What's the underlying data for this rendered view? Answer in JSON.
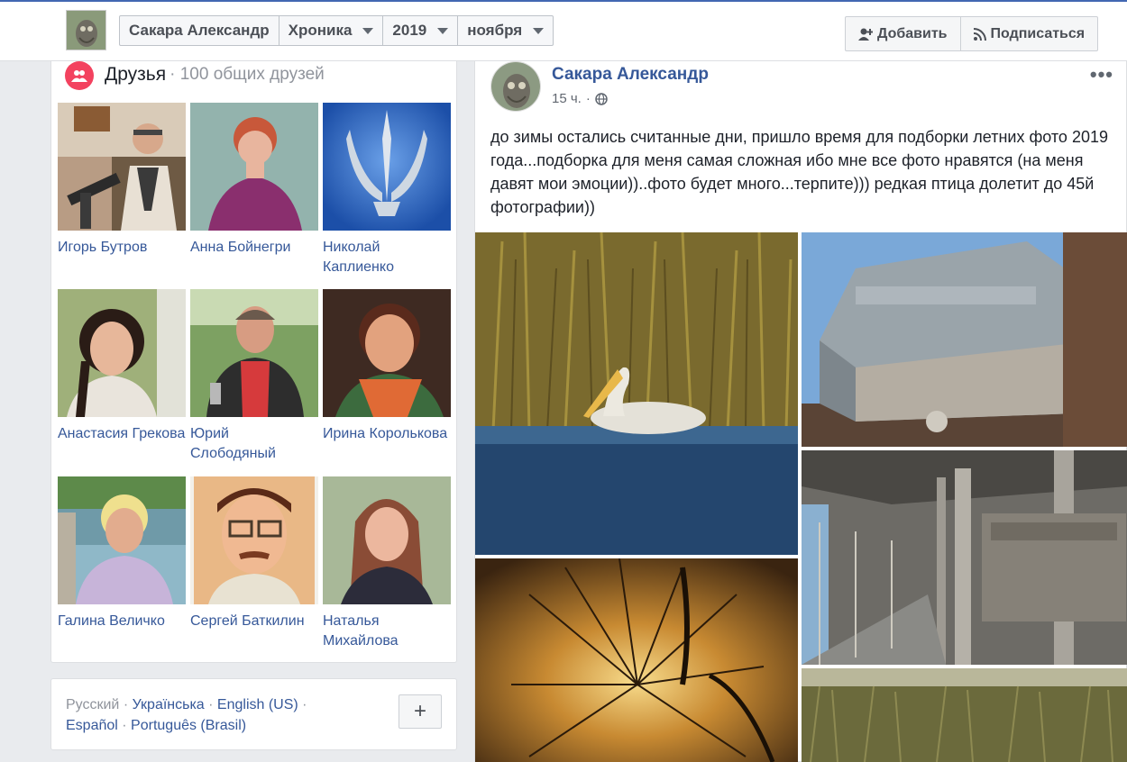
{
  "header": {
    "profile_name": "Сакара Александр",
    "crumbs": [
      {
        "label": "Сакара Александр",
        "has_caret": false
      },
      {
        "label": "Хроника",
        "has_caret": true
      },
      {
        "label": "2019",
        "has_caret": true
      },
      {
        "label": "ноября",
        "has_caret": true
      }
    ],
    "add_button": "Добавить",
    "subscribe_button": "Подписаться",
    "accent_color": "#4267b2"
  },
  "friends": {
    "title": "Друзья",
    "mutual": "· 100 общих друзей",
    "icon_color": "#f3425f",
    "items": [
      {
        "name": "Игорь Бутров"
      },
      {
        "name": "Анна Бойнегри"
      },
      {
        "name": "Николай Каплиенко"
      },
      {
        "name": "Анастасия Грекова"
      },
      {
        "name": "Юрий Слободяный"
      },
      {
        "name": "Ирина Королькова"
      },
      {
        "name": "Галина Величко"
      },
      {
        "name": "Сергей Баткилин"
      },
      {
        "name": "Наталья Михайлова"
      }
    ]
  },
  "footer": {
    "languages": [
      "Русский",
      "Українська",
      "English (US)",
      "Español",
      "Português (Brasil)"
    ],
    "add_language_label": "+"
  },
  "post": {
    "author": "Сакара Александр",
    "time": "15 ч.",
    "privacy_icon": "globe-icon",
    "more_label": "•••",
    "text": "до зимы остались считанные дни, пришло время для подборки летних фото 2019 года...подборка для меня самая сложная ибо мне все фото нравятся (на меня давят мои эмоции))..фото будет много...терпите))) редкая птица долетит до 45й фотографии))",
    "photos": [
      "pelican-photo",
      "ship-photo",
      "dandelion-photo",
      "ship-interior-photo",
      "grass-photo"
    ]
  }
}
